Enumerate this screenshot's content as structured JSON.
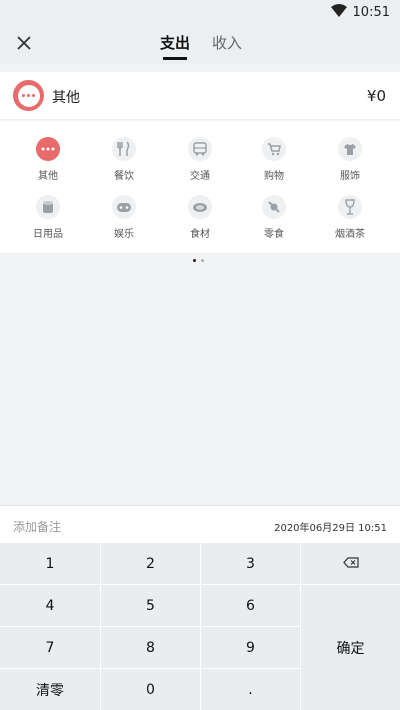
{
  "status_bar": {
    "time": "10:51",
    "wifi_icon": "wifi-icon"
  },
  "header": {
    "close_icon": "close-icon",
    "tabs": [
      {
        "label": "支出",
        "active": true
      },
      {
        "label": "收入",
        "active": false
      }
    ]
  },
  "selected_category": {
    "name": "其他",
    "amount": "¥0",
    "icon": "more-dots-icon",
    "color": "#e86a6a"
  },
  "categories": [
    {
      "label": "其他",
      "icon": "more-dots-icon",
      "selected": true
    },
    {
      "label": "餐饮",
      "icon": "fork-knife-icon",
      "selected": false
    },
    {
      "label": "交通",
      "icon": "bus-icon",
      "selected": false
    },
    {
      "label": "购物",
      "icon": "cart-icon",
      "selected": false
    },
    {
      "label": "服饰",
      "icon": "shirt-icon",
      "selected": false
    },
    {
      "label": "日用品",
      "icon": "tissue-roll-icon",
      "selected": false
    },
    {
      "label": "娱乐",
      "icon": "gamepad-icon",
      "selected": false
    },
    {
      "label": "食材",
      "icon": "steak-icon",
      "selected": false
    },
    {
      "label": "零食",
      "icon": "candy-icon",
      "selected": false
    },
    {
      "label": "烟酒茶",
      "icon": "wine-glass-icon",
      "selected": false
    }
  ],
  "pager": {
    "page_count": 2,
    "current": 1
  },
  "remark": {
    "placeholder": "添加备注",
    "datetime": "2020年06月29日 10:51"
  },
  "keypad": {
    "keys": [
      "1",
      "2",
      "3",
      "4",
      "5",
      "6",
      "7",
      "8",
      "9",
      "清零",
      "0",
      "."
    ],
    "backspace_icon": "backspace-icon",
    "confirm_label": "确定"
  },
  "colors": {
    "accent": "#e86a6a",
    "header_bg": "#eceff1",
    "keypad_bg": "#e9edf0"
  }
}
